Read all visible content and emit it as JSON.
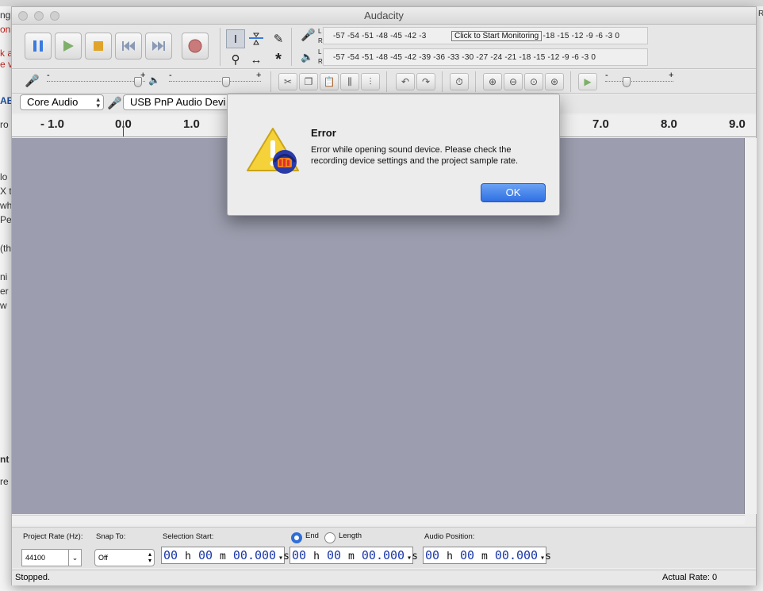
{
  "window": {
    "title": "Audacity"
  },
  "transport": {
    "pause": "pause-icon",
    "play": "play-icon",
    "stop": "stop-icon",
    "skip_start": "skip-to-start-icon",
    "skip_end": "skip-to-end-icon",
    "record": "record-icon"
  },
  "meters": {
    "record_scale": "-57 -54 -51 -48 -45 -42 -3",
    "record_scale_tail": "21 -18 -15 -12 -9 -6 -3 0",
    "playback_scale": "-57 -54 -51 -48 -45 -42 -39 -36 -33 -30 -27 -24 -21 -18 -15 -12 -9 -6 -3 0",
    "monitor_tooltip": "Click to Start Monitoring",
    "left": "L",
    "right": "R"
  },
  "slider_labels": {
    "minus": "-",
    "plus": "+"
  },
  "device": {
    "host": "Core Audio",
    "input": "USB PnP Audio Devi"
  },
  "ruler": {
    "labels": [
      "- 1.0",
      "0.0",
      "1.0",
      "7.0",
      "8.0",
      "9.0"
    ]
  },
  "selection_bar": {
    "project_rate_label": "Project Rate (Hz):",
    "project_rate_value": "44100",
    "snap_to_label": "Snap To:",
    "snap_to_value": "Off",
    "selection_start_label": "Selection Start:",
    "end_label": "End",
    "length_label": "Length",
    "audio_position_label": "Audio Position:",
    "time_hours": "00",
    "time_minutes": "00",
    "time_seconds": "00.000",
    "unit_h": "h",
    "unit_m": "m",
    "unit_s": "s",
    "dropdown": "▾"
  },
  "status": {
    "text": "Stopped.",
    "actual_rate": "Actual Rate: 0"
  },
  "dialog": {
    "title": "Error",
    "message": "Error while opening sound device. Please check the recording device settings and the project sample rate.",
    "ok_label": "OK"
  },
  "background_fragments": {
    "left": [
      "ng",
      "on",
      "k a",
      "e v",
      "AB",
      "ro",
      "lo",
      "X t",
      "wh",
      "Pe",
      "(th",
      "ni",
      "er",
      "w",
      "nt",
      "re"
    ],
    "right": [
      "RI"
    ]
  },
  "colors": {
    "track_bg": "#9c9eaf",
    "ok_button": "#2f6fe2",
    "time_digits": "#1a37a8",
    "error_text": "#c0261f"
  }
}
